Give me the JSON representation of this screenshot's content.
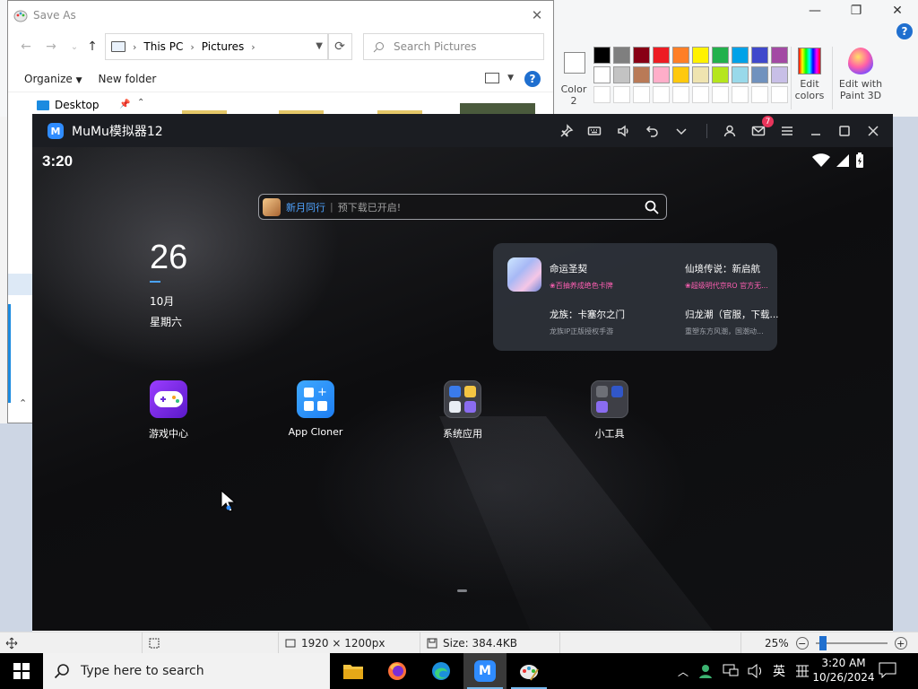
{
  "paint": {
    "color2_label_line1": "Color",
    "color2_label_line2": "2",
    "edit_colors_line1": "Edit",
    "edit_colors_line2": "colors",
    "paint3d_line1": "Edit with",
    "paint3d_line2": "Paint 3D",
    "palette_row1": [
      "#000000",
      "#7f7f7f",
      "#880015",
      "#ed1c24",
      "#ff7f27",
      "#fff200",
      "#22b14c",
      "#00a2e8",
      "#3f48cc",
      "#a349a4"
    ],
    "palette_row2": [
      "#ffffff",
      "#c3c3c3",
      "#b97a57",
      "#ffaec9",
      "#ffc90e",
      "#efe4b0",
      "#b5e61d",
      "#99d9ea",
      "#7092be",
      "#c8bfe7"
    ],
    "palette_row3": [
      "#ffffff",
      "#ffffff",
      "#ffffff",
      "#ffffff",
      "#ffffff",
      "#ffffff",
      "#ffffff",
      "#ffffff",
      "#ffffff",
      "#ffffff"
    ],
    "status": {
      "dimensions": "1920 × 1200px",
      "size": "Size: 384.4KB",
      "zoom": "25%",
      "zoom_fraction": 0.25
    }
  },
  "save_as": {
    "title": "Save As",
    "breadcrumb": [
      "This PC",
      "Pictures"
    ],
    "search_placeholder": "Search Pictures",
    "organize": "Organize",
    "new_folder": "New folder",
    "help": "?",
    "tree_item": "Desktop"
  },
  "mumu": {
    "title": "MuMu模拟器12",
    "logo_letter": "M",
    "mail_badge": "7",
    "status_time": "3:20",
    "search_promo": "新月同行",
    "search_divider": "|",
    "search_hint": "预下载已开启!",
    "date_day": "26",
    "date_month": "10月",
    "date_weekday": "星期六",
    "games": [
      {
        "name": "命运圣契",
        "sub": "❀百抽养成绝色卡牌"
      },
      {
        "name": "仙境传说：新启航",
        "sub": "❀超级明代京RO 官方无..."
      },
      {
        "name": "龙族：卡塞尔之门",
        "sub": "龙族IP正版授权手游"
      },
      {
        "name": "归龙潮（官服，下载...",
        "sub": "重塑东方风潮，国潮动..."
      }
    ],
    "apps": [
      {
        "label": "游戏中心"
      },
      {
        "label": "App Cloner"
      },
      {
        "label": "系统应用"
      },
      {
        "label": "小工具"
      }
    ]
  },
  "taskbar": {
    "search_placeholder": "Type here to search",
    "ime_lang": "英",
    "time": "3:20 AM",
    "date": "10/26/2024"
  }
}
